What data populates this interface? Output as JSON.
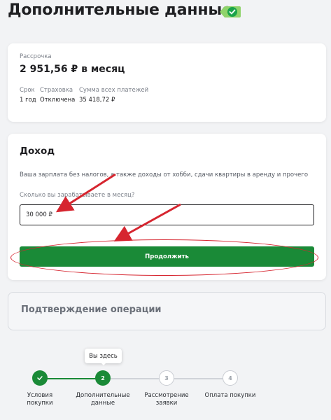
{
  "page_title": "Дополнительные данные",
  "installment": {
    "label": "Рассрочка",
    "amount": "2 951,56 ₽ в месяц",
    "term_label": "Срок",
    "term_value": "1 год",
    "insurance_label": "Страховка",
    "insurance_value": "Отключена",
    "total_label": "Сумма всех платежей",
    "total_value": "35 418,72 ₽"
  },
  "income": {
    "title": "Доход",
    "description": "Ваша зарплата без налогов, а также доходы от хобби, сдачи квартиры в аренду и прочего",
    "question": "Сколько вы зарабатываете в месяц?",
    "input_value": "30 000 ₽",
    "continue_label": "Продолжить"
  },
  "confirm": {
    "title": "Подтверждение операции"
  },
  "stepper": {
    "tooltip": "Вы здесь",
    "steps": [
      {
        "number": "✓",
        "line1": "Условия",
        "line2": "покупки"
      },
      {
        "number": "2",
        "line1": "Дополнительные",
        "line2": "данные"
      },
      {
        "number": "3",
        "line1": "Рассмотрение",
        "line2": "заявки"
      },
      {
        "number": "4",
        "line1": "Оплата покупки",
        "line2": ""
      }
    ]
  },
  "colors": {
    "accent": "#1a8a37",
    "annotation": "#d6252f"
  },
  "icons": {
    "title_badge": "sber-check-badge-icon"
  }
}
